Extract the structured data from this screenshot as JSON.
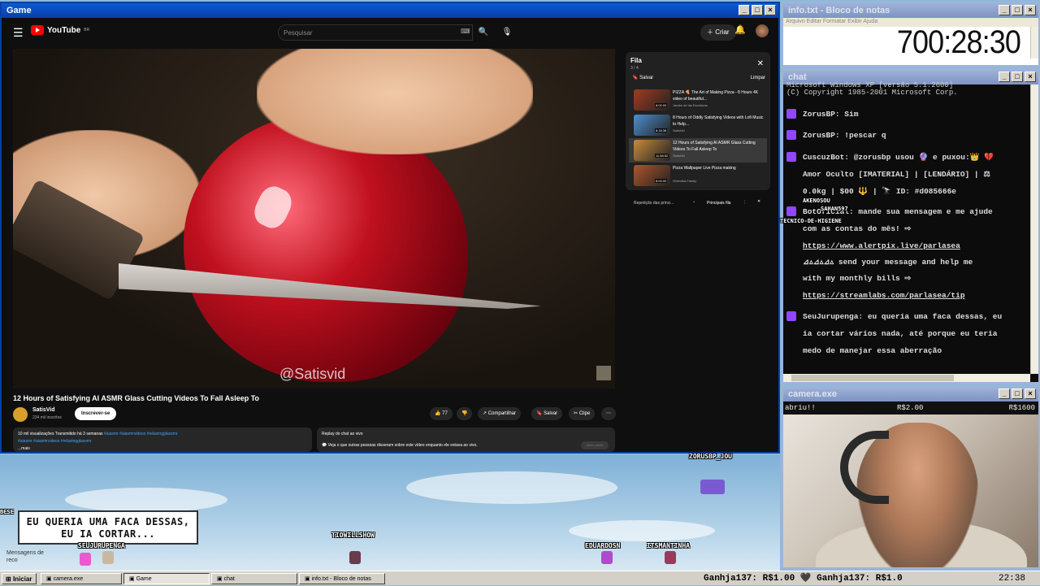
{
  "game_window": {
    "title": "Game",
    "youtube": {
      "logo_text": "YouTube",
      "logo_region": "BR",
      "search_placeholder": "Pesquisar",
      "create_label": "Criar",
      "video": {
        "watermark": "@Satisvid",
        "title": "12 Hours of Satisfying AI ASMR Glass Cutting Videos To Fall Asleep To",
        "channel": "SatisVid",
        "subscribers": "234 mil inscritos",
        "subscribe_label": "Inscrever-se",
        "likes": "77",
        "share_label": "Compartilhar",
        "save_label": "Salvar",
        "clip_label": "Clipe"
      },
      "description": {
        "stats": "10 mil visualizações  Transmitido há 3 semanas",
        "tags1": "#aiasmr #aiasmrvideos #relaxingglassmr",
        "tags2": "#aiasmr #aiasmrvideos #relaxingglassmr",
        "more": "...mais"
      },
      "chat_replay": {
        "title": "Replay do chat ao vivo",
        "text": "Veja o que outras pessoas disseram sobre este vídeo enquanto ele estava ao vivo.",
        "button": "Abrir painel"
      },
      "queue": {
        "title": "Fila",
        "count": "3 / 4",
        "save_label": "Salvar",
        "clear_label": "Limpar",
        "items": [
          {
            "title": "PIZZA 🍕 The Art of Making Pizza - 8 Hours 4K video of beautiful...",
            "channel": "Jardim de las Escrituras",
            "duration": "8:00:00",
            "thumb": "#a33b1f"
          },
          {
            "title": "8 Hours of Oddly Satisfying Videos with Lofi Music to Help...",
            "channel": "SatisVid",
            "duration": "8:18:38",
            "thumb": "#4d8fd1"
          },
          {
            "title": "12 Hours of Satisfying AI ASMR Glass Cutting Videos To Fall Asleep To",
            "channel": "SatisVid",
            "duration": "11:58:52",
            "thumb": "#c98b3d"
          },
          {
            "title": "Pizza Wallpaper Live Pizza making",
            "channel": "Shreotha Family",
            "duration": "8:00:00",
            "thumb": "#b0552c"
          }
        ]
      },
      "playlist_bar": {
        "label": "Repetição das princi...",
        "main_queue": "Principais fila"
      }
    }
  },
  "notepad_window": {
    "title": "info.txt - Bloco de notas",
    "menu": "Arquivo  Editar  Formatar  Exibir  Ajuda",
    "clock_text": "700:28:30"
  },
  "chat_window": {
    "title": "chat",
    "header1": "Microsoft Windows XP [versão 5.1.2600]",
    "header2": "(C) Copyright 1985-2001 Microsoft Corp.",
    "messages": [
      "ZorusBP: Sim",
      "ZorusBP: !pescar q",
      "CuscuzBot: @zorusbp usou 🔮 e puxou:👑 💔",
      "Amor Oculto [IMATERIAL] | [LENDÁRIO] | ⚖",
      "0.0kg | $00 🔱 | 🔭 ID: #d085666e",
      "BotOficial: mande sua mensagem e me ajude",
      "com as contas do mês! ⇨",
      "https://www.alertpix.live/parlasea",
      "⊿▵⊿▵⊿▵ send your message and help me",
      "with my monthly bills ⇨",
      "https://streamlabs.com/parlasea/tip",
      "SeuJurupenga: eu queria uma faca dessas, eu",
      "ia cortar vários nada, até porque eu teria",
      "medo de manejar essa aberração"
    ],
    "overlay_names": [
      "AKENOSOU",
      "SAHAN597",
      "TECNICO-DE-HIGIENE"
    ]
  },
  "camera_window": {
    "title": "camera.exe",
    "top_left": "abriu!!",
    "top_mid": "R$2.00",
    "top_right": "R$1600"
  },
  "stream_overlay": {
    "speech": "EU QUERIA UMA FACA DESSAS, EU IA CORTAR...",
    "names": [
      "SEUJURUPENGA",
      "TIOWILLSHOW",
      "EDUARDOSN",
      "ITSMANTINHA",
      "ZORUSBP_JOU"
    ],
    "corner_label": "Mensagens de reco",
    "left_label": "BESE"
  },
  "taskbar": {
    "start_label": "Iniciar",
    "tasks": [
      "camera.exe",
      "Game",
      "chat",
      "info.txt - Bloco de notas"
    ],
    "ticker": "Ganhja137: R$1.00  🖤  Ganhja137: R$1.0",
    "clock": "22:38"
  }
}
